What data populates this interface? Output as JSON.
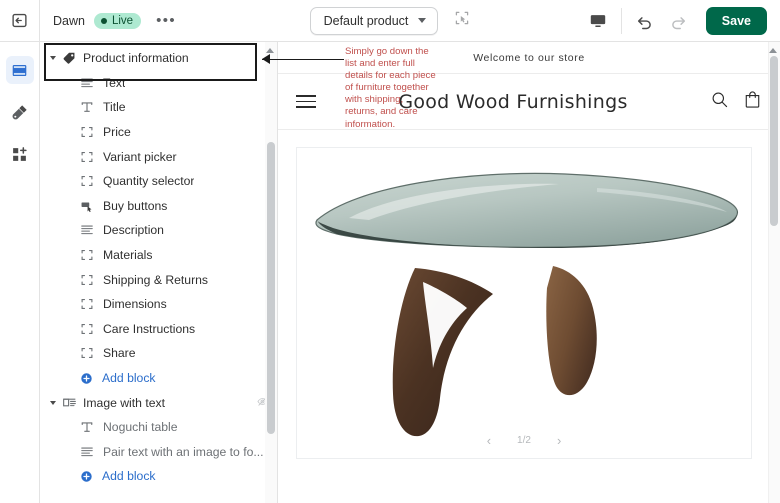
{
  "topbar": {
    "exit_icon": "exit-arrow-icon",
    "theme_name": "Dawn",
    "live_label": "Live",
    "more_label": "•••",
    "product_select_value": "Default product",
    "select_target_icon": "select-target-icon",
    "device_icon": "desktop-icon",
    "undo_icon": "undo-icon",
    "redo_icon": "redo-icon",
    "save_label": "Save"
  },
  "rail": {
    "items": [
      {
        "name": "sections-icon",
        "label": "Sections",
        "active": true
      },
      {
        "name": "theme-settings-icon",
        "label": "Theme settings",
        "active": false
      },
      {
        "name": "apps-icon",
        "label": "Apps",
        "active": false
      }
    ]
  },
  "sidebar": {
    "rows": [
      {
        "type": "section",
        "label": "Product information",
        "icon": "tag-icon",
        "selected": true,
        "expanded": true
      },
      {
        "type": "block",
        "label": "Text",
        "icon": "text-lines-icon"
      },
      {
        "type": "block",
        "label": "Title",
        "icon": "title-t-icon"
      },
      {
        "type": "block",
        "label": "Price",
        "icon": "custom-block-icon"
      },
      {
        "type": "block",
        "label": "Variant picker",
        "icon": "custom-block-icon"
      },
      {
        "type": "block",
        "label": "Quantity selector",
        "icon": "custom-block-icon"
      },
      {
        "type": "block",
        "label": "Buy buttons",
        "icon": "buy-buttons-icon"
      },
      {
        "type": "block",
        "label": "Description",
        "icon": "text-lines-icon"
      },
      {
        "type": "block",
        "label": "Materials",
        "icon": "custom-block-icon"
      },
      {
        "type": "block",
        "label": "Shipping & Returns",
        "icon": "custom-block-icon"
      },
      {
        "type": "block",
        "label": "Dimensions",
        "icon": "custom-block-icon"
      },
      {
        "type": "block",
        "label": "Care Instructions",
        "icon": "custom-block-icon"
      },
      {
        "type": "block",
        "label": "Share",
        "icon": "custom-block-icon"
      },
      {
        "type": "add",
        "label": "Add block",
        "icon": "add-circle-icon"
      },
      {
        "type": "section",
        "label": "Image with text",
        "icon": "image-with-text-icon",
        "hidden_icon": "eye-off-icon",
        "expanded": true
      },
      {
        "type": "block",
        "label": "Noguchi table",
        "icon": "title-t-icon",
        "dim": true
      },
      {
        "type": "block",
        "label": "Pair text with an image to fo...",
        "icon": "text-lines-icon",
        "dim": true
      },
      {
        "type": "add",
        "label": "Add block",
        "icon": "add-circle-icon"
      }
    ]
  },
  "preview": {
    "announcement": "Welcome to our store",
    "menu_icon": "hamburger-icon",
    "store_title": "Good Wood Furnishings",
    "search_icon": "search-icon",
    "cart_icon": "cart-icon",
    "zoom_icon": "zoom-in-icon",
    "product_image_alt": "Noguchi glass and walnut coffee table",
    "pager": {
      "prev": "‹",
      "counter": "1/2",
      "next": "›"
    }
  },
  "annotations": {
    "callout_text": "Simply go down the list and enter full details for each piece of furniture together with shipping, returns, and care information.",
    "callout_color": "#c0504d",
    "highlight_color": "#1a1a1a"
  },
  "colors": {
    "brand_green": "#00684a",
    "live_badge_bg": "#aee9d1",
    "link_blue": "#2c6ecb",
    "rail_active_bg": "#eaf1fb"
  }
}
